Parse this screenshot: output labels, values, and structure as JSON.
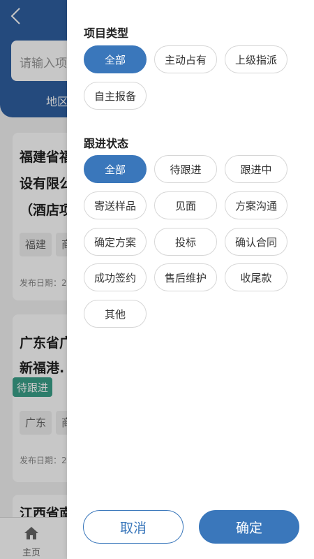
{
  "background": {
    "search_placeholder": "请输入项",
    "region_label": "地区",
    "cards": [
      {
        "title_line1": "福建省福",
        "title_line2": "设有限公",
        "title_line3": "（酒店项",
        "tag1": "福建",
        "tag2": "商",
        "date": "发布日期：2"
      },
      {
        "title_line1": "广东省广",
        "title_line2": "新福港.",
        "status": "待跟进",
        "tag1": "广东",
        "tag2": "商",
        "date": "发布日期：2"
      },
      {
        "title_line1": "江西省南"
      }
    ],
    "tabbar": {
      "home_label": "主页"
    }
  },
  "filter": {
    "project_type": {
      "title": "项目类型",
      "options": [
        "全部",
        "主动占有",
        "上级指派",
        "自主报备"
      ],
      "selected": 0
    },
    "follow_status": {
      "title": "跟进状态",
      "options": [
        "全部",
        "待跟进",
        "跟进中",
        "寄送样品",
        "见面",
        "方案沟通",
        "确定方案",
        "投标",
        "确认合同",
        "成功签约",
        "售后维护",
        "收尾款",
        "其他"
      ],
      "selected": 0
    },
    "cancel_label": "取消",
    "confirm_label": "确定"
  },
  "colors": {
    "accent": "#3a77bb",
    "header": "#2f5fa0",
    "status_green": "#3aa08a"
  },
  "icons": {
    "back": "chevron-left-icon",
    "home": "home-icon"
  }
}
